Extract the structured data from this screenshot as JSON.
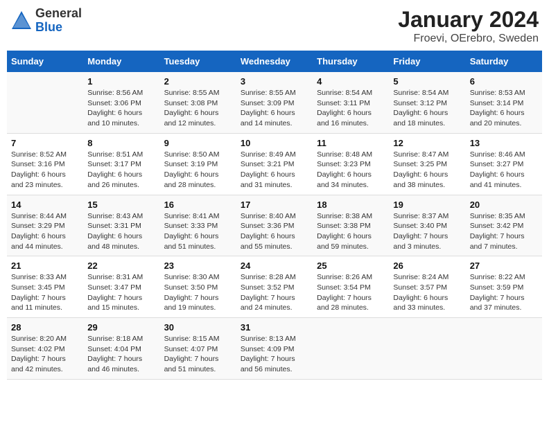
{
  "logo": {
    "general": "General",
    "blue": "Blue"
  },
  "title": "January 2024",
  "subtitle": "Froevi, OErebro, Sweden",
  "weekdays": [
    "Sunday",
    "Monday",
    "Tuesday",
    "Wednesday",
    "Thursday",
    "Friday",
    "Saturday"
  ],
  "weeks": [
    [
      {
        "day": "",
        "info": ""
      },
      {
        "day": "1",
        "info": "Sunrise: 8:56 AM\nSunset: 3:06 PM\nDaylight: 6 hours\nand 10 minutes."
      },
      {
        "day": "2",
        "info": "Sunrise: 8:55 AM\nSunset: 3:08 PM\nDaylight: 6 hours\nand 12 minutes."
      },
      {
        "day": "3",
        "info": "Sunrise: 8:55 AM\nSunset: 3:09 PM\nDaylight: 6 hours\nand 14 minutes."
      },
      {
        "day": "4",
        "info": "Sunrise: 8:54 AM\nSunset: 3:11 PM\nDaylight: 6 hours\nand 16 minutes."
      },
      {
        "day": "5",
        "info": "Sunrise: 8:54 AM\nSunset: 3:12 PM\nDaylight: 6 hours\nand 18 minutes."
      },
      {
        "day": "6",
        "info": "Sunrise: 8:53 AM\nSunset: 3:14 PM\nDaylight: 6 hours\nand 20 minutes."
      }
    ],
    [
      {
        "day": "7",
        "info": "Sunrise: 8:52 AM\nSunset: 3:16 PM\nDaylight: 6 hours\nand 23 minutes."
      },
      {
        "day": "8",
        "info": "Sunrise: 8:51 AM\nSunset: 3:17 PM\nDaylight: 6 hours\nand 26 minutes."
      },
      {
        "day": "9",
        "info": "Sunrise: 8:50 AM\nSunset: 3:19 PM\nDaylight: 6 hours\nand 28 minutes."
      },
      {
        "day": "10",
        "info": "Sunrise: 8:49 AM\nSunset: 3:21 PM\nDaylight: 6 hours\nand 31 minutes."
      },
      {
        "day": "11",
        "info": "Sunrise: 8:48 AM\nSunset: 3:23 PM\nDaylight: 6 hours\nand 34 minutes."
      },
      {
        "day": "12",
        "info": "Sunrise: 8:47 AM\nSunset: 3:25 PM\nDaylight: 6 hours\nand 38 minutes."
      },
      {
        "day": "13",
        "info": "Sunrise: 8:46 AM\nSunset: 3:27 PM\nDaylight: 6 hours\nand 41 minutes."
      }
    ],
    [
      {
        "day": "14",
        "info": "Sunrise: 8:44 AM\nSunset: 3:29 PM\nDaylight: 6 hours\nand 44 minutes."
      },
      {
        "day": "15",
        "info": "Sunrise: 8:43 AM\nSunset: 3:31 PM\nDaylight: 6 hours\nand 48 minutes."
      },
      {
        "day": "16",
        "info": "Sunrise: 8:41 AM\nSunset: 3:33 PM\nDaylight: 6 hours\nand 51 minutes."
      },
      {
        "day": "17",
        "info": "Sunrise: 8:40 AM\nSunset: 3:36 PM\nDaylight: 6 hours\nand 55 minutes."
      },
      {
        "day": "18",
        "info": "Sunrise: 8:38 AM\nSunset: 3:38 PM\nDaylight: 6 hours\nand 59 minutes."
      },
      {
        "day": "19",
        "info": "Sunrise: 8:37 AM\nSunset: 3:40 PM\nDaylight: 7 hours\nand 3 minutes."
      },
      {
        "day": "20",
        "info": "Sunrise: 8:35 AM\nSunset: 3:42 PM\nDaylight: 7 hours\nand 7 minutes."
      }
    ],
    [
      {
        "day": "21",
        "info": "Sunrise: 8:33 AM\nSunset: 3:45 PM\nDaylight: 7 hours\nand 11 minutes."
      },
      {
        "day": "22",
        "info": "Sunrise: 8:31 AM\nSunset: 3:47 PM\nDaylight: 7 hours\nand 15 minutes."
      },
      {
        "day": "23",
        "info": "Sunrise: 8:30 AM\nSunset: 3:50 PM\nDaylight: 7 hours\nand 19 minutes."
      },
      {
        "day": "24",
        "info": "Sunrise: 8:28 AM\nSunset: 3:52 PM\nDaylight: 7 hours\nand 24 minutes."
      },
      {
        "day": "25",
        "info": "Sunrise: 8:26 AM\nSunset: 3:54 PM\nDaylight: 7 hours\nand 28 minutes."
      },
      {
        "day": "26",
        "info": "Sunrise: 8:24 AM\nSunset: 3:57 PM\nDaylight: 6 hours\nand 33 minutes."
      },
      {
        "day": "27",
        "info": "Sunrise: 8:22 AM\nSunset: 3:59 PM\nDaylight: 7 hours\nand 37 minutes."
      }
    ],
    [
      {
        "day": "28",
        "info": "Sunrise: 8:20 AM\nSunset: 4:02 PM\nDaylight: 7 hours\nand 42 minutes."
      },
      {
        "day": "29",
        "info": "Sunrise: 8:18 AM\nSunset: 4:04 PM\nDaylight: 7 hours\nand 46 minutes."
      },
      {
        "day": "30",
        "info": "Sunrise: 8:15 AM\nSunset: 4:07 PM\nDaylight: 7 hours\nand 51 minutes."
      },
      {
        "day": "31",
        "info": "Sunrise: 8:13 AM\nSunset: 4:09 PM\nDaylight: 7 hours\nand 56 minutes."
      },
      {
        "day": "",
        "info": ""
      },
      {
        "day": "",
        "info": ""
      },
      {
        "day": "",
        "info": ""
      }
    ]
  ]
}
